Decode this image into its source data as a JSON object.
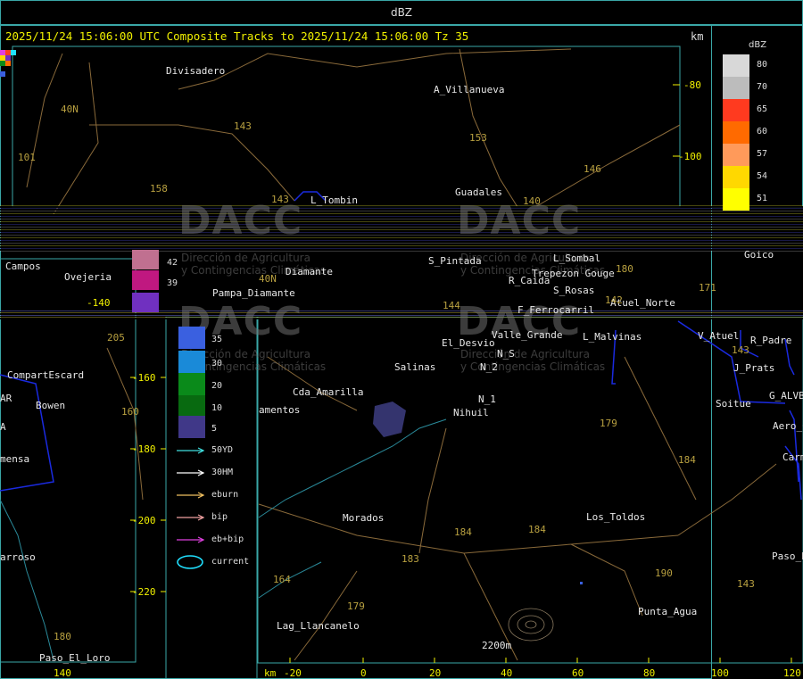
{
  "window": {
    "title": "dBZ"
  },
  "header": {
    "text": "2025/11/24 15:06:00 UTC Composite Tracks to 2025/11/24 15:06:00 Tz 35",
    "km_label": "km"
  },
  "legend": {
    "title": "dBZ",
    "levels": [
      {
        "value": "80",
        "color": "#d8d8d8"
      },
      {
        "value": "70",
        "color": "#bcbcbc"
      },
      {
        "value": "65",
        "color": "#ff3a1f"
      },
      {
        "value": "60",
        "color": "#ff6a00"
      },
      {
        "value": "57",
        "color": "#ff9a5a"
      },
      {
        "value": "54",
        "color": "#ffd800"
      },
      {
        "value": "51",
        "color": "#ffff00"
      }
    ]
  },
  "legend_lower": {
    "levels": [
      {
        "value": "42",
        "color": "#c07090"
      },
      {
        "value": "39",
        "color": "#c01880"
      },
      {
        "value": "35",
        "color": "#3a60e0"
      },
      {
        "value": "30",
        "color": "#1a8ad8"
      },
      {
        "value": "20",
        "color": "#0a8a1a"
      },
      {
        "value": "10",
        "color": "#086a10"
      },
      {
        "value": "5",
        "color": "#403888"
      }
    ],
    "purple_block_color": "#7030c0"
  },
  "tracks_legend": [
    {
      "label": "50YD",
      "color": "#40e0e0"
    },
    {
      "label": "30HM",
      "color": "#ffffff"
    },
    {
      "label": "eburn",
      "color": "#f0c060"
    },
    {
      "label": "bip",
      "color": "#f0a0a0"
    },
    {
      "label": "eb+bip",
      "color": "#e040e0"
    },
    {
      "label": "current",
      "color": "#20e0ff"
    }
  ],
  "y_axis_right": [
    "-80",
    "-100"
  ],
  "y_axis_left": [
    "-140",
    "-160",
    "-180",
    "-200",
    "-220"
  ],
  "x_axis": {
    "unit": "km",
    "ticks": [
      "-20",
      "0",
      "20",
      "40",
      "60",
      "80",
      "100",
      "120"
    ]
  },
  "x_axis_left_tick": "140",
  "places": [
    {
      "name": "Divisadero"
    },
    {
      "name": "A_Villanueva"
    },
    {
      "name": "Guadales"
    },
    {
      "name": "L_Tombin"
    },
    {
      "name": "Campos"
    },
    {
      "name": "Ovejeria"
    },
    {
      "name": "Pampa_Diamante"
    },
    {
      "name": "Diamante"
    },
    {
      "name": "S_Pintada"
    },
    {
      "name": "R_Caida"
    },
    {
      "name": "S_Rosas"
    },
    {
      "name": "Trepezon Gouge"
    },
    {
      "name": "Atuel_Norte"
    },
    {
      "name": "Goico"
    },
    {
      "name": "El_Desvio"
    },
    {
      "name": "Valle_Grande"
    },
    {
      "name": "L_Malvinas"
    },
    {
      "name": "V_Atuel"
    },
    {
      "name": "R_Padre"
    },
    {
      "name": "J_Prats"
    },
    {
      "name": "Salinas"
    },
    {
      "name": "N_2"
    },
    {
      "name": "N_S"
    },
    {
      "name": "N_1"
    },
    {
      "name": "Nihuil"
    },
    {
      "name": "CompartEscard"
    },
    {
      "name": "Bowen"
    },
    {
      "name": "Cda_Amarilla"
    },
    {
      "name": "amentos"
    },
    {
      "name": "Soitue"
    },
    {
      "name": "G_ALVB"
    },
    {
      "name": "Aero_C"
    },
    {
      "name": "Carm"
    },
    {
      "name": "mensa"
    },
    {
      "name": "Morados"
    },
    {
      "name": "Los_Toldos"
    },
    {
      "name": "Paso_E"
    },
    {
      "name": "arroso"
    },
    {
      "name": "Punta_Agua"
    },
    {
      "name": "Lag_Llancanelo"
    },
    {
      "name": "Paso_El_Loro"
    },
    {
      "name": "F_Ferrocarril"
    },
    {
      "name": "L_Sombal"
    },
    {
      "name": "AR"
    },
    {
      "name": "A"
    },
    {
      "name": "2200m"
    }
  ],
  "roads": [
    "101",
    "40N",
    "143",
    "153",
    "146",
    "140",
    "158",
    "143",
    "40N",
    "144",
    "142",
    "205",
    "160",
    "179",
    "184",
    "171",
    "143",
    "180",
    "164",
    "184",
    "183",
    "179",
    "190",
    "143",
    "180",
    "184"
  ],
  "watermark": {
    "brand": "DACC",
    "line1": "Dirección de Agricultura",
    "line2": "y Contingencias Climáticas"
  }
}
